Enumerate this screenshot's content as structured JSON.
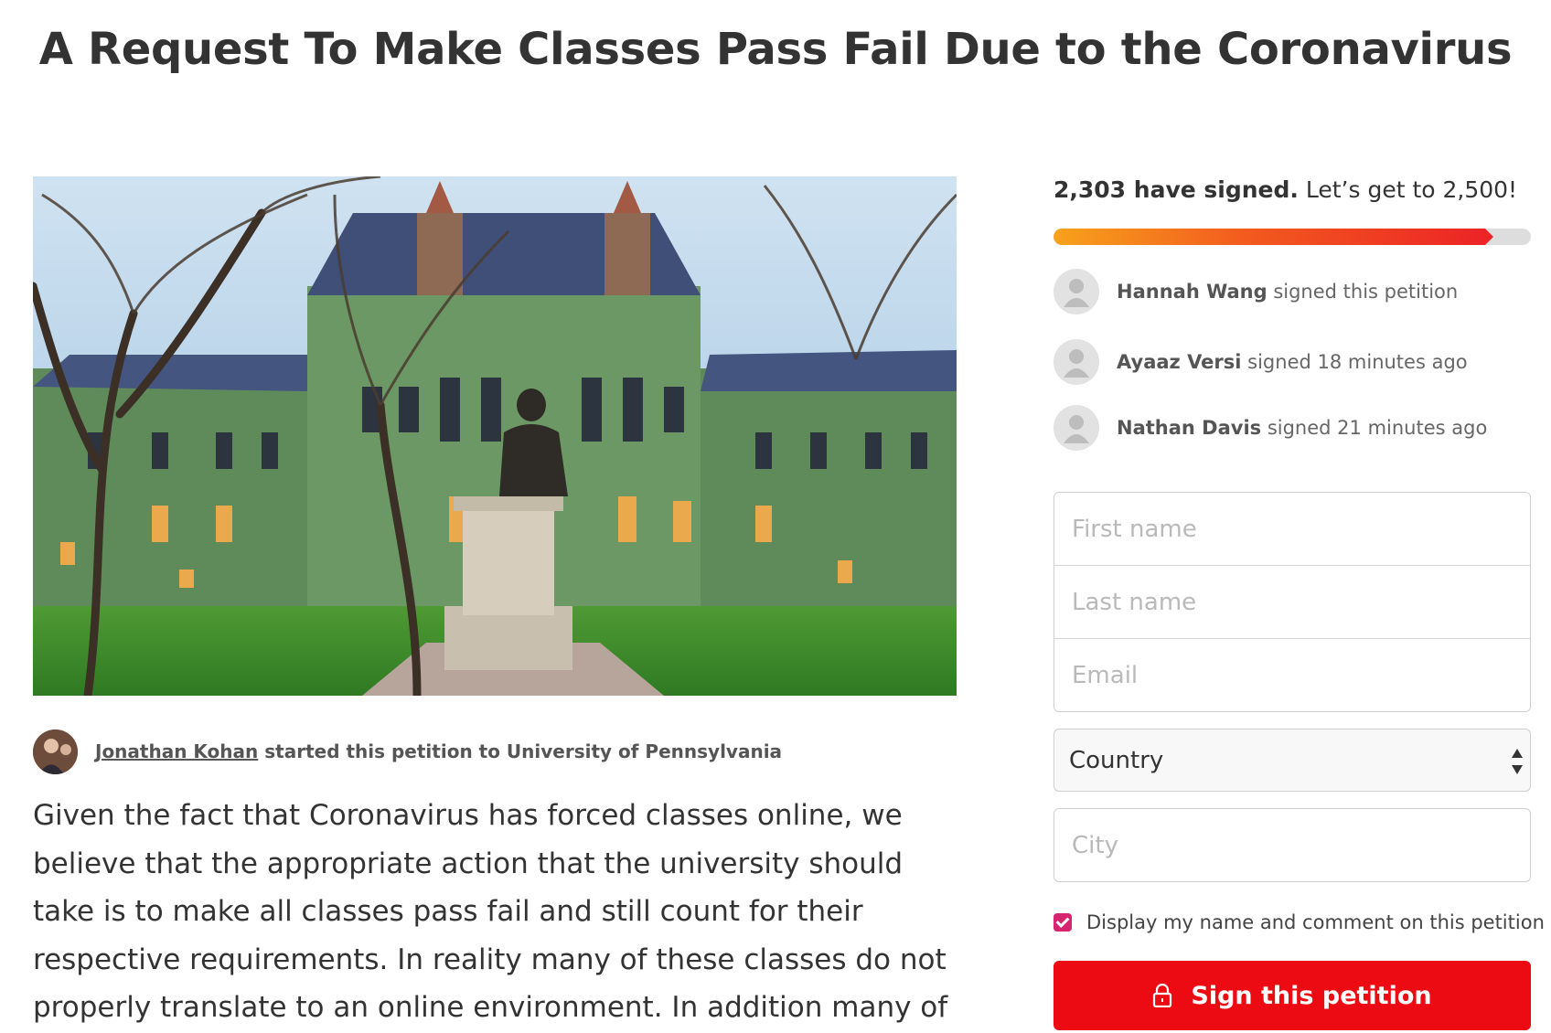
{
  "title": "A Request To Make Classes Pass Fail Due to the Coronavirus",
  "starter": {
    "name": "Jonathan Kohan",
    "text": " started this petition to University of Pennsylvania"
  },
  "body_text": "Given the fact that Coronavirus has forced classes online, we believe that the appropriate action that the university should take is to make all classes pass fail and still count for their respective requirements. In reality many of these classes do not properly translate to an online environment. In addition many of",
  "progress": {
    "signed_label": "2,303 have signed.",
    "goal_label": " Let’s get to 2,500!",
    "signed": 2303,
    "goal": 2500
  },
  "signers": [
    {
      "name": "Hannah Wang",
      "action": " signed this petition"
    },
    {
      "name": "Ayaaz Versi",
      "action": " signed 18 minutes ago"
    },
    {
      "name": "Nathan Davis",
      "action": " signed 21 minutes ago"
    }
  ],
  "form": {
    "first_name_placeholder": "First name",
    "last_name_placeholder": "Last name",
    "email_placeholder": "Email",
    "country_value": "Country",
    "city_placeholder": "City",
    "display_label": "Display my name and comment on this petition",
    "display_checked": true,
    "sign_label": "Sign this petition"
  },
  "colors": {
    "accent": "#ec0b12",
    "checkbox": "#d6246e",
    "progress_start": "#f7a21c",
    "progress_end": "#ec2426"
  },
  "icons": {
    "signer_avatar": "person-silhouette-icon",
    "sign_button": "lock-icon",
    "select": "up-down-arrows-icon"
  }
}
